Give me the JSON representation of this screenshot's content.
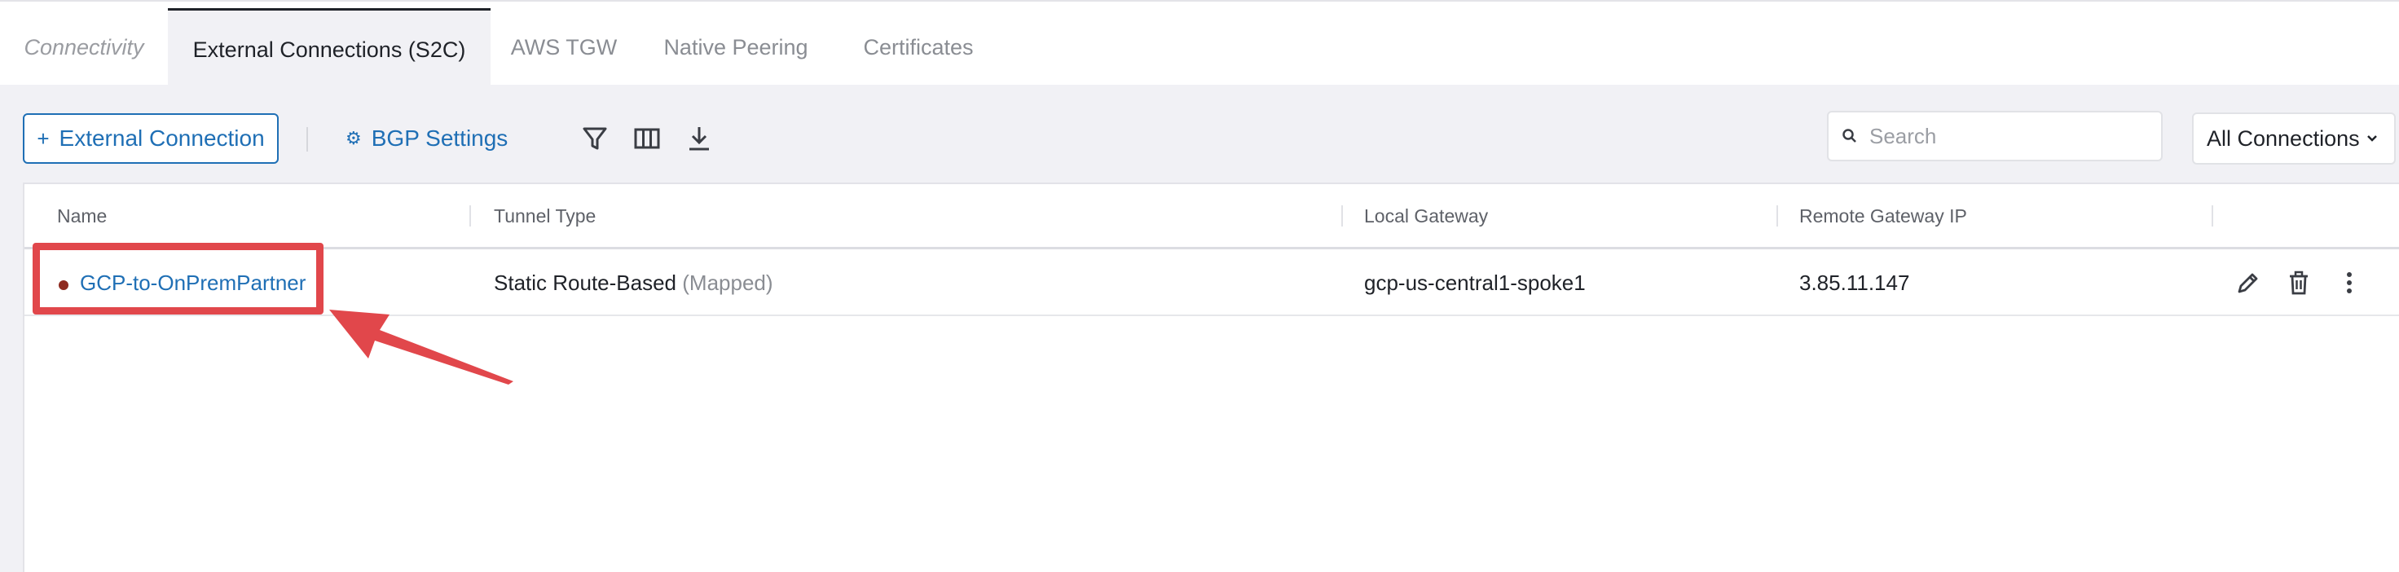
{
  "tabs": [
    {
      "label": "Connectivity"
    },
    {
      "label": "External Connections (S2C)"
    },
    {
      "label": "AWS TGW"
    },
    {
      "label": "Native Peering"
    },
    {
      "label": "Certificates"
    }
  ],
  "toolbar": {
    "add_label": "External Connection",
    "bgp_label": "BGP Settings",
    "search_placeholder": "Search",
    "filter_value": "All Connections"
  },
  "table": {
    "columns": [
      "Name",
      "Tunnel Type",
      "Local Gateway",
      "Remote Gateway IP"
    ],
    "rows": [
      {
        "name": "GCP-to-OnPremPartner",
        "tunnel_type": "Static Route-Based",
        "tunnel_mode": "(Mapped)",
        "local_gateway": "gcp-us-central1-spoke1",
        "remote_gateway_ip": "3.85.11.147"
      }
    ]
  },
  "colors": {
    "accent": "#1f6fb5",
    "status_dot": "#8e2a1f",
    "annotation": "#e1474b"
  },
  "icons": [
    "plus-icon",
    "gear-icon",
    "filter-icon",
    "columns-icon",
    "download-icon",
    "search-icon",
    "chevron-down-icon",
    "edit-icon",
    "delete-icon",
    "more-icon"
  ]
}
